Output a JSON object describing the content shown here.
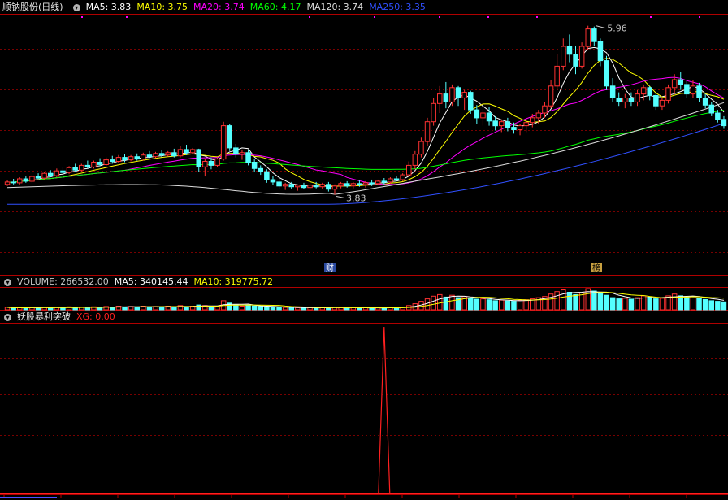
{
  "main": {
    "title": "顺钠股份(日线)",
    "ma": [
      {
        "label": "MA5: 3.83",
        "color": "#ffffff"
      },
      {
        "label": "MA10: 3.75",
        "color": "#ffff00"
      },
      {
        "label": "MA20: 3.74",
        "color": "#ff00ff"
      },
      {
        "label": "MA60: 4.17",
        "color": "#00ff00"
      },
      {
        "label": "MA120: 3.74",
        "color": "#dcdcdc"
      },
      {
        "label": "MA250: 3.35",
        "color": "#3050ff"
      }
    ],
    "high_label": "5.96",
    "low_label": "3.83",
    "markers": [
      {
        "text": "财",
        "bg": "#2a4aa0",
        "fg": "#ffffff"
      },
      {
        "text": "榜",
        "bg": "#c8a040",
        "fg": "#000000"
      }
    ]
  },
  "volume": {
    "labels": [
      {
        "label": "VOLUME: 266532.00",
        "color": "#c8c8c8"
      },
      {
        "label": "MA5: 340145.44",
        "color": "#ffffff"
      },
      {
        "label": "MA10: 319775.72",
        "color": "#ffff00"
      }
    ]
  },
  "indicator": {
    "title": "妖股暴利突破",
    "labels": [
      {
        "label": "XG: 0.00",
        "color": "#ff2020"
      }
    ]
  },
  "chart_data": [
    {
      "type": "candlestick",
      "y_range": [
        2.8,
        6.1
      ],
      "high": {
        "value": 5.96,
        "bar_index": 95
      },
      "low": {
        "value": 3.83,
        "bar_index": 53
      },
      "ohlc": [
        [
          3.96,
          4.01,
          3.94,
          3.99
        ],
        [
          3.99,
          4.03,
          3.96,
          3.98
        ],
        [
          3.98,
          4.05,
          3.96,
          4.03
        ],
        [
          4.03,
          4.06,
          3.98,
          4.0
        ],
        [
          4.0,
          4.08,
          3.98,
          4.06
        ],
        [
          4.06,
          4.1,
          4.03,
          4.04
        ],
        [
          4.04,
          4.12,
          4.01,
          4.1
        ],
        [
          4.1,
          4.14,
          4.05,
          4.07
        ],
        [
          4.07,
          4.16,
          4.05,
          4.13
        ],
        [
          4.13,
          4.18,
          4.09,
          4.11
        ],
        [
          4.11,
          4.19,
          4.09,
          4.17
        ],
        [
          4.17,
          4.22,
          4.12,
          4.14
        ],
        [
          4.14,
          4.22,
          4.12,
          4.2
        ],
        [
          4.2,
          4.26,
          4.16,
          4.18
        ],
        [
          4.18,
          4.26,
          4.16,
          4.24
        ],
        [
          4.24,
          4.29,
          4.19,
          4.21
        ],
        [
          4.21,
          4.3,
          4.19,
          4.27
        ],
        [
          4.27,
          4.32,
          4.22,
          4.25
        ],
        [
          4.25,
          4.33,
          4.23,
          4.3
        ],
        [
          4.3,
          4.34,
          4.24,
          4.27
        ],
        [
          4.27,
          4.33,
          4.25,
          4.31
        ],
        [
          4.31,
          4.35,
          4.26,
          4.28
        ],
        [
          4.28,
          4.36,
          4.26,
          4.33
        ],
        [
          4.33,
          4.38,
          4.29,
          4.31
        ],
        [
          4.31,
          4.37,
          4.29,
          4.35
        ],
        [
          4.35,
          4.39,
          4.3,
          4.33
        ],
        [
          4.33,
          4.38,
          4.31,
          4.36
        ],
        [
          4.36,
          4.41,
          4.3,
          4.32
        ],
        [
          4.32,
          4.45,
          4.3,
          4.4
        ],
        [
          4.4,
          4.46,
          4.33,
          4.36
        ],
        [
          4.36,
          4.42,
          4.34,
          4.4
        ],
        [
          4.4,
          4.41,
          4.12,
          4.18
        ],
        [
          4.18,
          4.28,
          4.06,
          4.25
        ],
        [
          4.25,
          4.3,
          4.15,
          4.2
        ],
        [
          4.2,
          4.3,
          4.18,
          4.28
        ],
        [
          4.28,
          4.75,
          4.26,
          4.7
        ],
        [
          4.7,
          4.72,
          4.38,
          4.42
        ],
        [
          4.42,
          4.47,
          4.3,
          4.34
        ],
        [
          4.34,
          4.4,
          4.27,
          4.36
        ],
        [
          4.36,
          4.4,
          4.2,
          4.24
        ],
        [
          4.24,
          4.28,
          4.12,
          4.16
        ],
        [
          4.16,
          4.2,
          4.08,
          4.12
        ],
        [
          4.12,
          4.15,
          3.98,
          4.02
        ],
        [
          4.02,
          4.06,
          3.95,
          3.99
        ],
        [
          3.99,
          4.03,
          3.9,
          3.94
        ],
        [
          3.94,
          3.98,
          3.89,
          3.96
        ],
        [
          3.96,
          3.99,
          3.9,
          3.93
        ],
        [
          3.93,
          3.96,
          3.88,
          3.95
        ],
        [
          3.95,
          3.98,
          3.9,
          3.92
        ],
        [
          3.92,
          3.97,
          3.89,
          3.95
        ],
        [
          3.95,
          3.99,
          3.91,
          3.93
        ],
        [
          3.93,
          3.98,
          3.9,
          3.96
        ],
        [
          3.96,
          3.99,
          3.87,
          3.9
        ],
        [
          3.9,
          3.96,
          3.83,
          3.94
        ],
        [
          3.94,
          3.99,
          3.91,
          3.97
        ],
        [
          3.97,
          4.0,
          3.92,
          3.94
        ],
        [
          3.94,
          3.99,
          3.91,
          3.97
        ],
        [
          3.97,
          4.01,
          3.93,
          3.96
        ],
        [
          3.96,
          4.0,
          3.92,
          3.98
        ],
        [
          3.98,
          4.02,
          3.94,
          3.97
        ],
        [
          3.97,
          4.02,
          3.95,
          4.0
        ],
        [
          4.0,
          4.04,
          3.96,
          3.99
        ],
        [
          3.99,
          4.05,
          3.97,
          4.03
        ],
        [
          4.03,
          4.06,
          4.0,
          4.02
        ],
        [
          4.02,
          4.1,
          4.0,
          4.08
        ],
        [
          4.08,
          4.25,
          4.06,
          4.2
        ],
        [
          4.2,
          4.38,
          4.15,
          4.34
        ],
        [
          4.34,
          4.55,
          4.3,
          4.5
        ],
        [
          4.5,
          4.8,
          4.45,
          4.75
        ],
        [
          4.75,
          5.05,
          4.7,
          4.98
        ],
        [
          4.98,
          5.2,
          4.86,
          5.1
        ],
        [
          5.1,
          5.25,
          4.92,
          5.0
        ],
        [
          5.0,
          5.22,
          4.95,
          5.18
        ],
        [
          5.18,
          5.2,
          4.95,
          5.05
        ],
        [
          5.05,
          5.15,
          4.9,
          5.12
        ],
        [
          5.12,
          5.14,
          4.85,
          4.9
        ],
        [
          4.9,
          4.96,
          4.72,
          4.8
        ],
        [
          4.8,
          4.9,
          4.7,
          4.86
        ],
        [
          4.86,
          4.94,
          4.7,
          4.76
        ],
        [
          4.76,
          4.82,
          4.64,
          4.7
        ],
        [
          4.7,
          4.78,
          4.62,
          4.75
        ],
        [
          4.75,
          4.8,
          4.63,
          4.68
        ],
        [
          4.68,
          4.74,
          4.6,
          4.65
        ],
        [
          4.65,
          4.72,
          4.58,
          4.7
        ],
        [
          4.7,
          4.8,
          4.62,
          4.74
        ],
        [
          4.74,
          4.85,
          4.68,
          4.8
        ],
        [
          4.8,
          4.9,
          4.72,
          4.86
        ],
        [
          4.86,
          5.0,
          4.8,
          4.95
        ],
        [
          4.95,
          5.28,
          4.92,
          5.2
        ],
        [
          5.2,
          5.6,
          5.15,
          5.45
        ],
        [
          5.45,
          5.8,
          5.4,
          5.7
        ],
        [
          5.7,
          5.85,
          5.5,
          5.6
        ],
        [
          5.6,
          5.7,
          5.35,
          5.45
        ],
        [
          5.45,
          5.75,
          5.42,
          5.7
        ],
        [
          5.7,
          5.96,
          5.65,
          5.92
        ],
        [
          5.92,
          5.95,
          5.7,
          5.76
        ],
        [
          5.76,
          5.8,
          5.45,
          5.52
        ],
        [
          5.52,
          5.58,
          5.15,
          5.2
        ],
        [
          5.2,
          5.3,
          5.0,
          5.05
        ],
        [
          5.05,
          5.12,
          4.95,
          5.0
        ],
        [
          5.0,
          5.1,
          4.92,
          5.05
        ],
        [
          5.05,
          5.12,
          4.95,
          5.0
        ],
        [
          5.0,
          5.15,
          4.95,
          5.1
        ],
        [
          5.1,
          5.22,
          5.02,
          5.18
        ],
        [
          5.18,
          5.2,
          5.02,
          5.08
        ],
        [
          5.08,
          5.12,
          4.9,
          4.95
        ],
        [
          4.95,
          5.05,
          4.9,
          5.02
        ],
        [
          5.02,
          5.22,
          4.98,
          5.18
        ],
        [
          5.18,
          5.35,
          5.1,
          5.28
        ],
        [
          5.28,
          5.38,
          5.15,
          5.22
        ],
        [
          5.22,
          5.26,
          5.05,
          5.1
        ],
        [
          5.1,
          5.28,
          5.05,
          5.2
        ],
        [
          5.2,
          5.24,
          5.0,
          5.05
        ],
        [
          5.05,
          5.1,
          4.92,
          4.96
        ],
        [
          4.96,
          5.0,
          4.82,
          4.86
        ],
        [
          4.86,
          4.9,
          4.74,
          4.78
        ],
        [
          4.78,
          4.82,
          4.66,
          4.7
        ]
      ],
      "ma_periods": [
        5,
        10,
        20,
        60,
        120,
        250
      ],
      "ma_latest": [
        3.83,
        3.75,
        3.74,
        4.17,
        3.74,
        3.35
      ]
    },
    {
      "type": "bar",
      "name": "VOLUME",
      "volumes": [
        8,
        6,
        7,
        6,
        9,
        7,
        8,
        6,
        9,
        7,
        10,
        7,
        9,
        8,
        10,
        8,
        11,
        9,
        12,
        9,
        11,
        9,
        12,
        10,
        11,
        10,
        12,
        9,
        14,
        10,
        12,
        16,
        14,
        11,
        12,
        30,
        22,
        16,
        12,
        14,
        13,
        11,
        10,
        9,
        8,
        8,
        7,
        7,
        6,
        7,
        6,
        7,
        8,
        9,
        7,
        6,
        7,
        6,
        7,
        6,
        7,
        6,
        8,
        7,
        9,
        14,
        20,
        28,
        36,
        45,
        50,
        42,
        48,
        40,
        44,
        38,
        35,
        36,
        33,
        30,
        32,
        29,
        28,
        31,
        33,
        36,
        40,
        44,
        52,
        60,
        66,
        58,
        50,
        56,
        70,
        62,
        55,
        48,
        40,
        36,
        38,
        35,
        40,
        46,
        42,
        36,
        38,
        46,
        52,
        46,
        40,
        44,
        38,
        34,
        30,
        28,
        26
      ],
      "ma5": 340145.44,
      "ma10": 319775.72,
      "latest": 266532.0
    },
    {
      "type": "line",
      "name": "XG",
      "spike_index": 61,
      "y_range": [
        0,
        1
      ],
      "latest": 0.0
    }
  ]
}
